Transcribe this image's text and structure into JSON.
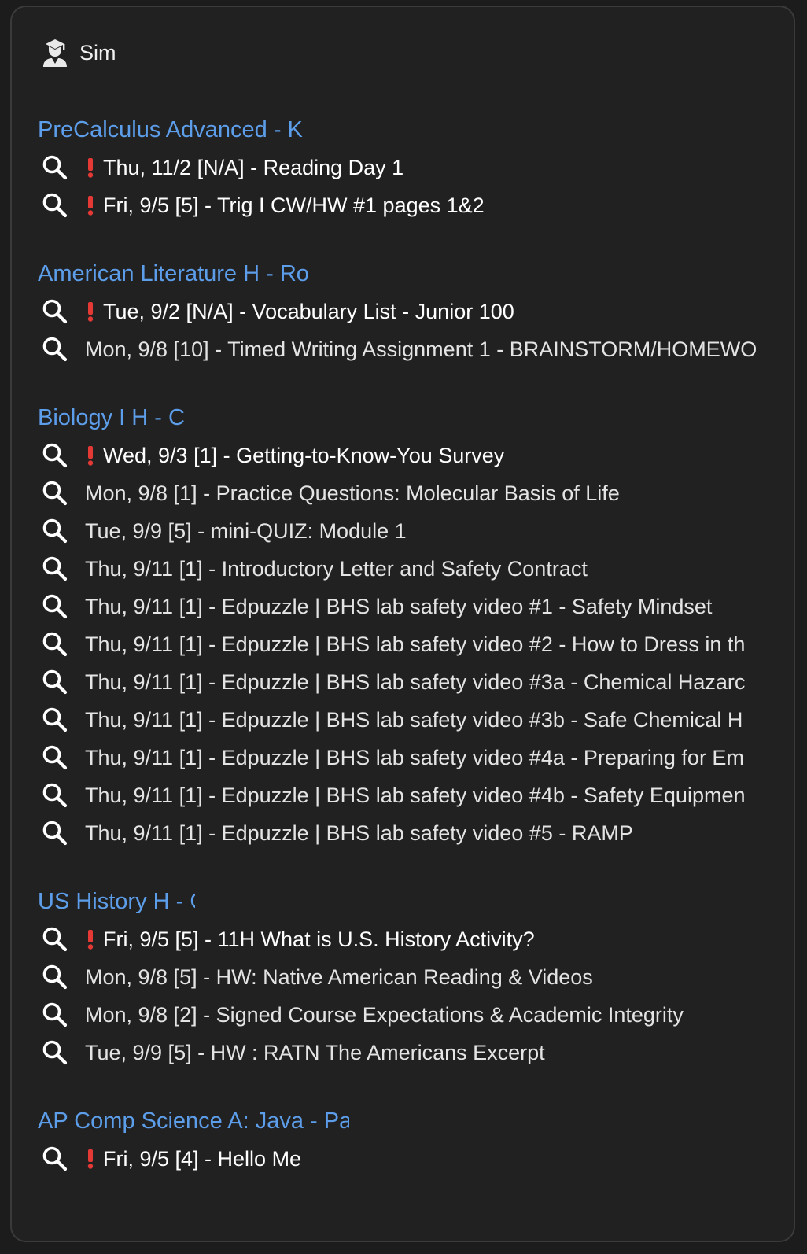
{
  "header": {
    "icon": "student-icon",
    "title": "Sim"
  },
  "colors": {
    "course_link": "#5d9eea",
    "alert": "#e53935",
    "background": "#212122"
  },
  "courses": [
    {
      "title": "PreCalculus Advanced - K",
      "tasks": [
        {
          "flag": true,
          "text": "Thu, 11/2 [N/A] - Reading Day 1"
        },
        {
          "flag": true,
          "text": "Fri, 9/5 [5] - Trig I CW/HW #1 pages 1&2"
        }
      ]
    },
    {
      "title": "American Literature H - Ro",
      "tasks": [
        {
          "flag": true,
          "text": "Tue, 9/2 [N/A] - Vocabulary List - Junior 100"
        },
        {
          "flag": false,
          "text": "Mon, 9/8 [10] - Timed Writing Assignment 1 - BRAINSTORM/HOMEWO"
        }
      ]
    },
    {
      "title": "Biology I H - C",
      "tasks": [
        {
          "flag": true,
          "text": "Wed, 9/3 [1] - Getting-to-Know-You Survey"
        },
        {
          "flag": false,
          "text": "Mon, 9/8 [1] - Practice Questions: Molecular Basis of Life"
        },
        {
          "flag": false,
          "text": "Tue, 9/9 [5] - mini-QUIZ: Module 1"
        },
        {
          "flag": false,
          "text": "Thu, 9/11 [1] - Introductory Letter and Safety Contract"
        },
        {
          "flag": false,
          "text": "Thu, 9/11 [1] - Edpuzzle | BHS lab safety video #1 - Safety Mindset"
        },
        {
          "flag": false,
          "text": "Thu, 9/11 [1] - Edpuzzle | BHS lab safety video #2 - How to Dress in th"
        },
        {
          "flag": false,
          "text": "Thu, 9/11 [1] - Edpuzzle | BHS lab safety video #3a - Chemical Hazarc"
        },
        {
          "flag": false,
          "text": "Thu, 9/11 [1] - Edpuzzle | BHS lab safety video #3b - Safe Chemical H"
        },
        {
          "flag": false,
          "text": "Thu, 9/11 [1] - Edpuzzle | BHS lab safety video #4a - Preparing for Em"
        },
        {
          "flag": false,
          "text": "Thu, 9/11 [1] - Edpuzzle | BHS lab safety video #4b - Safety Equipmen"
        },
        {
          "flag": false,
          "text": "Thu, 9/11 [1] - Edpuzzle | BHS lab safety video #5 - RAMP"
        }
      ]
    },
    {
      "title": "US History H - G",
      "tasks": [
        {
          "flag": true,
          "text": "Fri, 9/5 [5] - 11H What is U.S. History Activity?"
        },
        {
          "flag": false,
          "text": "Mon, 9/8 [5] - HW: Native American Reading & Videos"
        },
        {
          "flag": false,
          "text": "Mon, 9/8 [2] - Signed Course Expectations & Academic Integrity"
        },
        {
          "flag": false,
          "text": "Tue, 9/9 [5] - HW : RATN The Americans Excerpt"
        }
      ]
    },
    {
      "title": "AP Comp Science A: Java - Pa",
      "tasks": [
        {
          "flag": true,
          "text": "Fri, 9/5 [4] - Hello Me"
        }
      ]
    }
  ]
}
